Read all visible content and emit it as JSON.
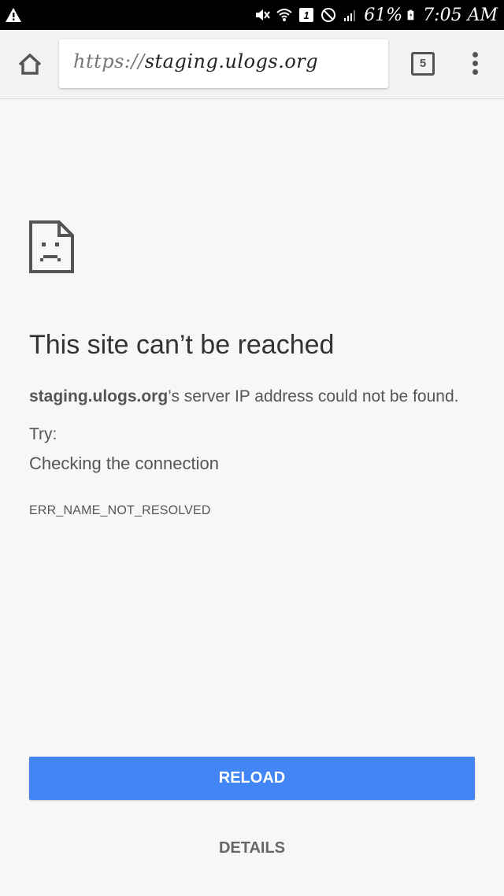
{
  "status_bar": {
    "battery_percent": "61%",
    "time": "7:05 AM",
    "notification_count": "1",
    "icons": [
      "warning-icon",
      "mute-icon",
      "wifi-icon",
      "notification-badge-icon",
      "do-not-disturb-icon",
      "signal-icon",
      "battery-icon"
    ]
  },
  "toolbar": {
    "url_scheme": "https://",
    "url_host": "staging.ulogs.org",
    "tab_count": "5",
    "icons": [
      "home-icon",
      "tabs-icon",
      "more-vert-icon"
    ]
  },
  "error": {
    "title": "This site can’t be reached",
    "host": "staging.ulogs.org",
    "message_suffix": "’s server IP address could not be found.",
    "try_label": "Try:",
    "suggestion": "Checking the connection",
    "code": "ERR_NAME_NOT_RESOLVED"
  },
  "buttons": {
    "reload": "RELOAD",
    "details": "DETAILS"
  },
  "colors": {
    "accent": "#4285f4",
    "background": "#f7f7f7",
    "status_bar": "#000000"
  }
}
